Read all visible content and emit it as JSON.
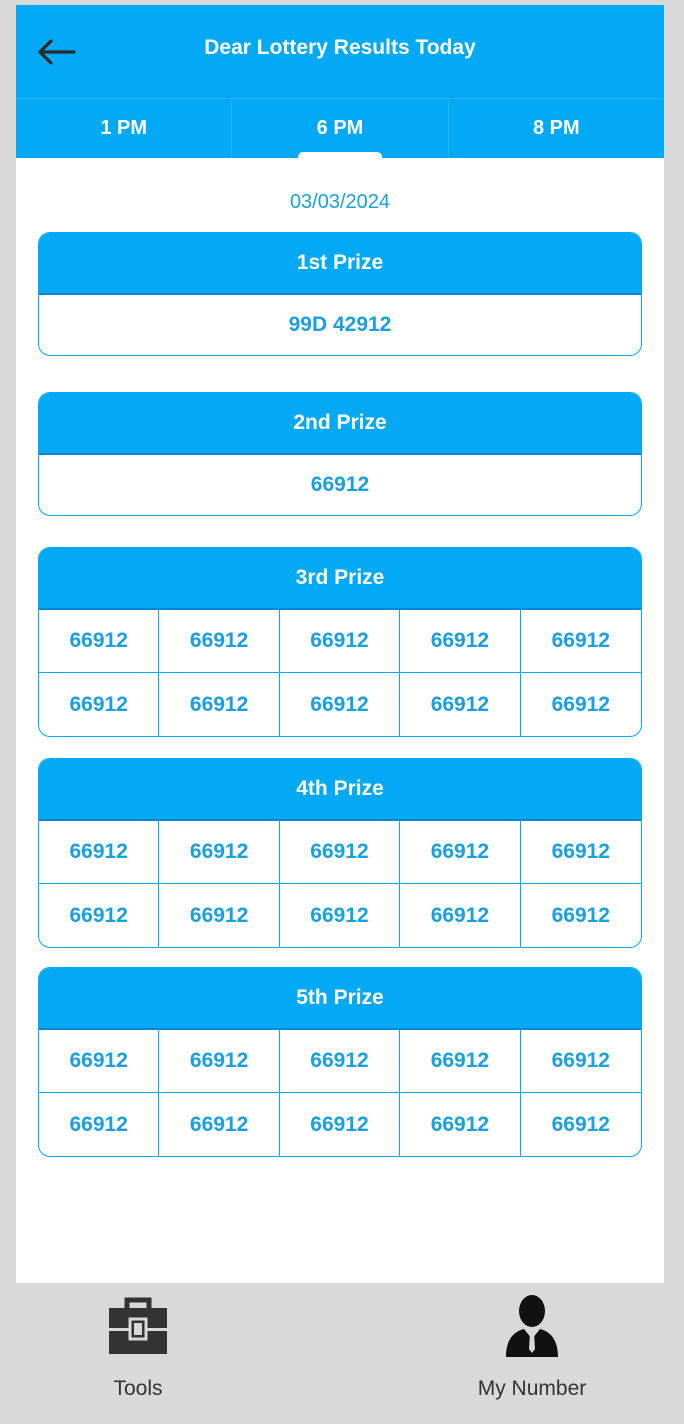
{
  "header": {
    "title": "Dear Lottery Results Today",
    "back_icon": "arrow-left-icon"
  },
  "tabs": [
    {
      "label": "1 PM",
      "active": false
    },
    {
      "label": "6 PM",
      "active": true
    },
    {
      "label": "8 PM",
      "active": false
    }
  ],
  "date": "03/03/2024",
  "prizes": {
    "first": {
      "title": "1st Prize",
      "number": "99D 42912"
    },
    "second": {
      "title": "2nd Prize",
      "number": "66912"
    },
    "third": {
      "title": "3rd Prize",
      "numbers": [
        "66912",
        "66912",
        "66912",
        "66912",
        "66912",
        "66912",
        "66912",
        "66912",
        "66912",
        "66912"
      ]
    },
    "fourth": {
      "title": "4th Prize",
      "numbers": [
        "66912",
        "66912",
        "66912",
        "66912",
        "66912",
        "66912",
        "66912",
        "66912",
        "66912",
        "66912"
      ]
    },
    "fifth": {
      "title": "5th Prize",
      "numbers": [
        "66912",
        "66912",
        "66912",
        "66912",
        "66912",
        "66912",
        "66912",
        "66912",
        "66912",
        "66912"
      ]
    }
  },
  "bottom_nav": [
    {
      "label": "Tools",
      "icon": "toolbox-icon"
    },
    {
      "label": "My Number",
      "icon": "user-icon"
    }
  ],
  "colors": {
    "accent": "#03a9f4",
    "number_text": "#1a9fe0",
    "bottom_bar": "#d9d9d9"
  }
}
